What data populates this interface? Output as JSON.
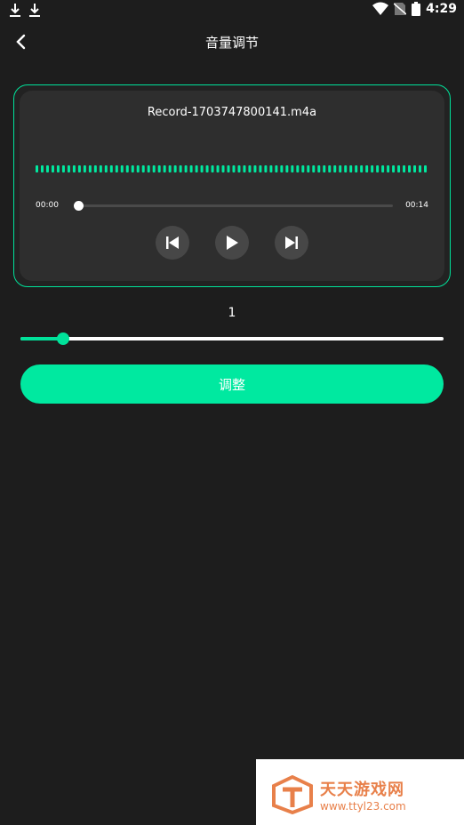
{
  "status_bar": {
    "time": "4:29",
    "left_icons": [
      "download-icon",
      "download-icon"
    ],
    "right_icons": [
      "wifi-icon",
      "no-sim-icon",
      "battery-icon"
    ]
  },
  "header": {
    "title": "音量调节",
    "back_icon": "chevron-left-icon"
  },
  "player": {
    "file_name": "Record-1703747800141.m4a",
    "current_time": "00:00",
    "total_time": "00:14",
    "progress": 0,
    "controls": [
      "skip-previous-icon",
      "play-icon",
      "skip-next-icon"
    ]
  },
  "volume": {
    "value": "1",
    "level_fraction": 0.1
  },
  "adjust_button": {
    "label": "调整"
  },
  "watermark": {
    "title": "天天游戏网",
    "url": "www.ttyl23.com"
  },
  "colors": {
    "accent": "#00e9a0",
    "background": "#1d1d1d",
    "card": "#2e2e2e",
    "watermark": "#e8804a"
  }
}
